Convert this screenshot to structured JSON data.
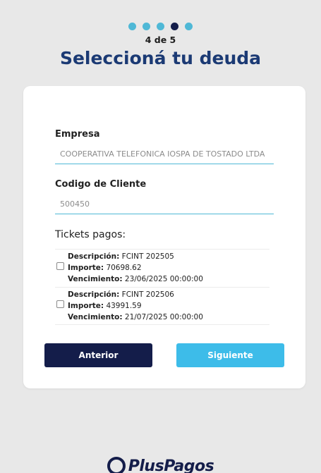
{
  "progress": {
    "current": 4,
    "total": 5,
    "label": "4 de 5"
  },
  "title": "Seleccioná tu deuda",
  "form": {
    "empresa": {
      "label": "Empresa",
      "value": "COOPERATIVA TELEFONICA IOSPA DE TOSTADO LTDA"
    },
    "cliente": {
      "label": "Codigo de Cliente",
      "value": "500450"
    }
  },
  "tickets": {
    "title": "Tickets pagos:",
    "items": [
      {
        "desc_label": "Descripción:",
        "desc": " FCINT 202505",
        "importe_label": "Importe:",
        "importe": " 70698.62",
        "venc_label": "Vencimiento:",
        "venc": " 23/06/2025 00:00:00",
        "checked": false
      },
      {
        "desc_label": "Descripción:",
        "desc": " FCINT 202506",
        "importe_label": "Importe:",
        "importe": " 43991.59",
        "venc_label": "Vencimiento:",
        "venc": " 21/07/2025 00:00:00",
        "checked": false
      }
    ]
  },
  "buttons": {
    "prev": "Anterior",
    "next": "Siguiente"
  },
  "brand": {
    "name": "PlusPagos"
  },
  "colors": {
    "accent": "#4fb8d6",
    "dark": "#141d4a",
    "title": "#1b3a74",
    "next_button": "#3dbce9"
  }
}
